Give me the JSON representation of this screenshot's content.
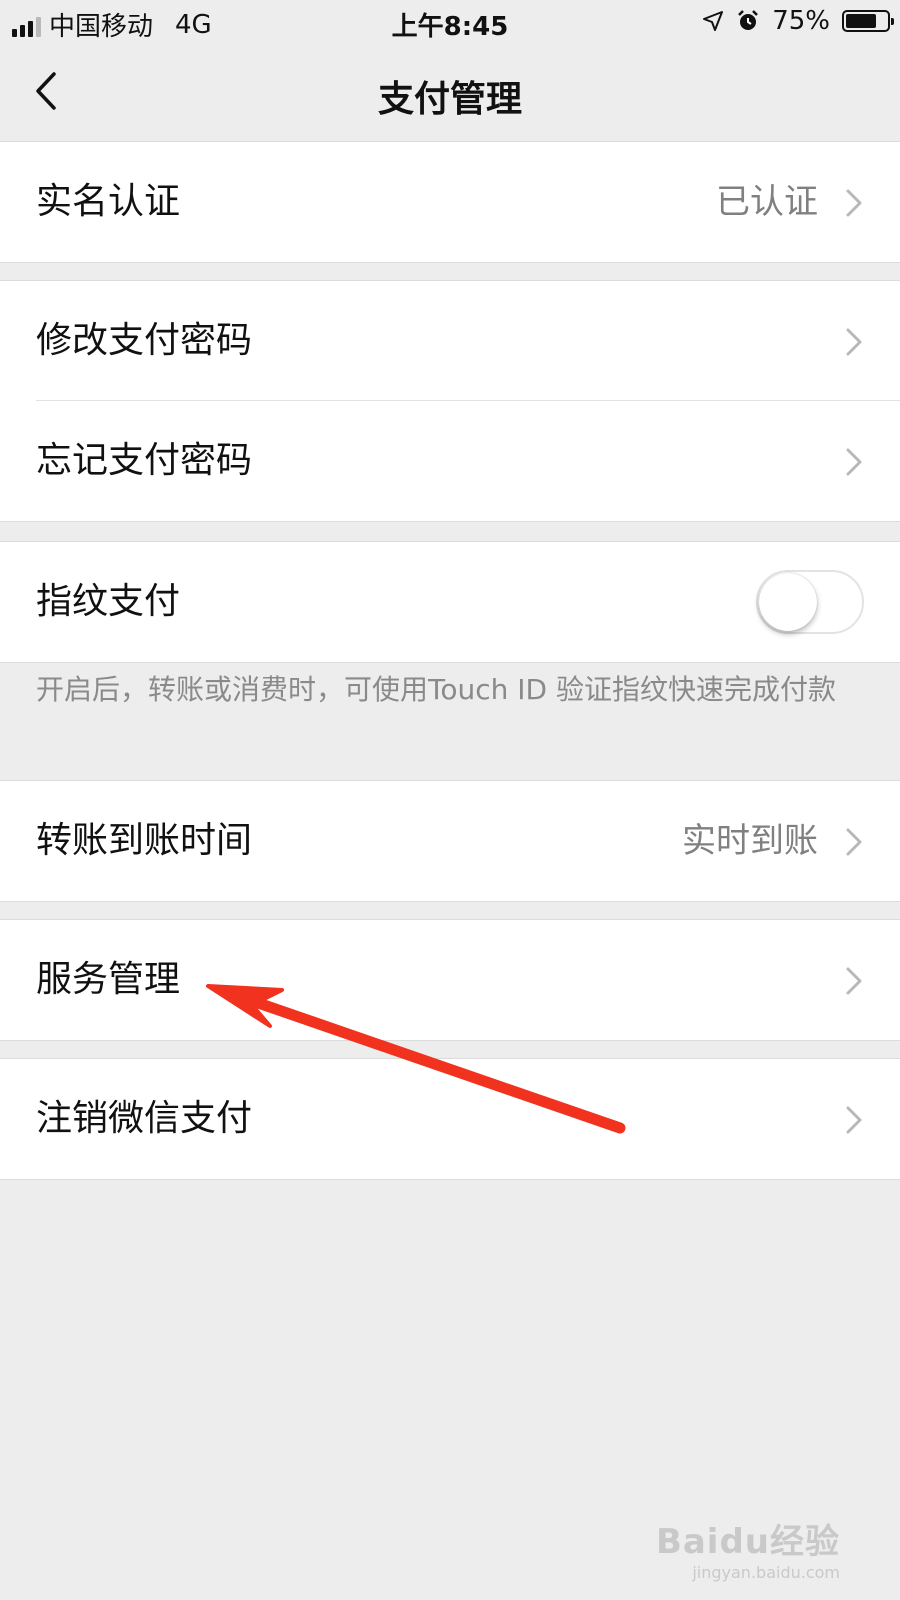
{
  "status_bar": {
    "carrier": "中国移动",
    "network": "4G",
    "time": "上午8:45",
    "battery": "75%",
    "battery_level": 0.75,
    "icons": [
      "signal-icon",
      "location-arrow-icon",
      "alarm-icon",
      "battery-icon"
    ]
  },
  "nav": {
    "title": "支付管理",
    "back_icon": "chevron-left-icon"
  },
  "sections": {
    "real_name": {
      "label": "实名认证",
      "value": "已认证"
    },
    "change_password": {
      "label": "修改支付密码"
    },
    "forgot_password": {
      "label": "忘记支付密码"
    },
    "fingerprint": {
      "label": "指纹支付",
      "enabled": false
    },
    "fingerprint_hint": "开启后，转账或消费时，可使用Touch ID 验证指纹快速完成付款",
    "transfer_time": {
      "label": "转账到账时间",
      "value": "实时到账"
    },
    "service_manage": {
      "label": "服务管理"
    },
    "deregister": {
      "label": "注销微信支付"
    }
  },
  "annotation": {
    "color": "#f0321e"
  },
  "watermark": {
    "main": "Baidu经验",
    "sub": "jingyan.baidu.com"
  }
}
